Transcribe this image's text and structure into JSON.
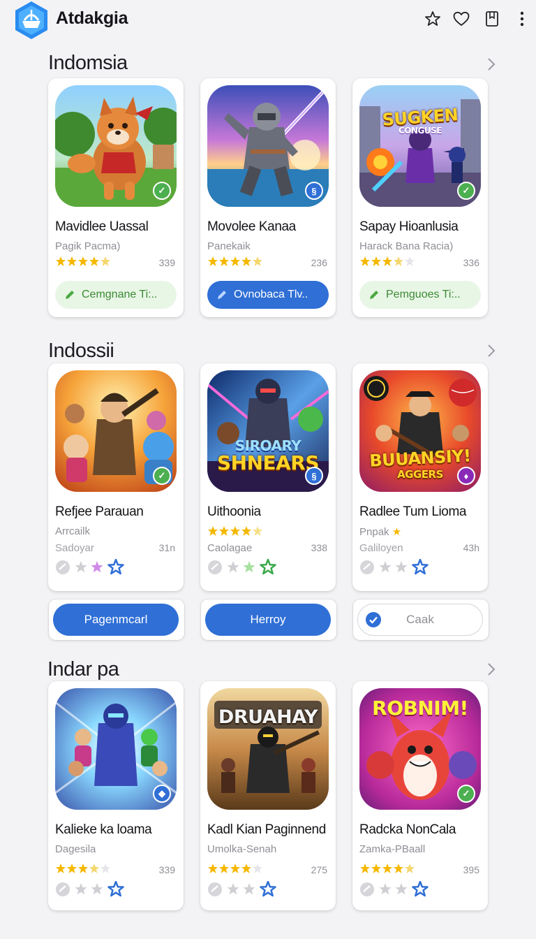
{
  "app": {
    "title": "Atdakgia"
  },
  "topbar_icons": [
    "star-icon",
    "heart-icon",
    "bookmark-icon",
    "more-vertical-icon"
  ],
  "sections": [
    {
      "title": "Indomsia",
      "cards": [
        {
          "title": "Mavidlee Uassal",
          "subtitle": "Pagik Pacma)",
          "rating_count": "339",
          "button": "Cemgnane Ti:..",
          "button_style": "green"
        },
        {
          "title": "Movolee Kanaa",
          "subtitle": "Panekaik",
          "rating_count": "236",
          "button": "Ovnobaca Tlv..",
          "button_style": "blue"
        },
        {
          "title": "Sapay Hioanlusia",
          "subtitle": "Harack Bana Racia)",
          "rating_count": "336",
          "button": "Pemguoes Ti:..",
          "button_style": "green",
          "art_text": [
            "SUGKEN",
            "CONGUSE"
          ]
        }
      ]
    },
    {
      "title": "Indossii",
      "cards": [
        {
          "title": "Refjee Parauan",
          "subtitle": "Arrcailk",
          "line3": "Sadoyar",
          "rating_count": "31n"
        },
        {
          "title": "Uithoonia",
          "line3": "Caolagae",
          "rating_count": "338",
          "art_text": [
            "SIROARY",
            "SHNEARS"
          ]
        },
        {
          "title": "Radlee Tum Lioma",
          "subtitle": "Pnpak",
          "line3": "Galiloyen",
          "rating_count": "43h",
          "art_text": [
            "BUUANSIY!",
            "AGGERS"
          ]
        }
      ],
      "actions": [
        {
          "label": "Pagenmcarl",
          "style": "blue"
        },
        {
          "label": "Herroy",
          "style": "blue"
        },
        {
          "label": "Caak",
          "style": "white"
        }
      ]
    },
    {
      "title": "Indar pa",
      "cards": [
        {
          "title": "Kalieke ka loama",
          "subtitle": "Dagesila",
          "rating_count": "339"
        },
        {
          "title": "Kadl Kian Paginnend",
          "subtitle": "Umolka-Senah",
          "rating_count": "275",
          "art_text": [
            "DRUAHAY"
          ]
        },
        {
          "title": "Radcka NonCala",
          "subtitle": "Zamka-PBaall",
          "rating_count": "395",
          "art_text": [
            "ROBNIM!"
          ]
        }
      ]
    }
  ],
  "colors": {
    "accent_blue": "#2f6fd6",
    "green_pill_bg": "#e8f6e6",
    "green_text": "#3d8a35",
    "star": "#f5b800",
    "background": "#f3f3f6"
  }
}
